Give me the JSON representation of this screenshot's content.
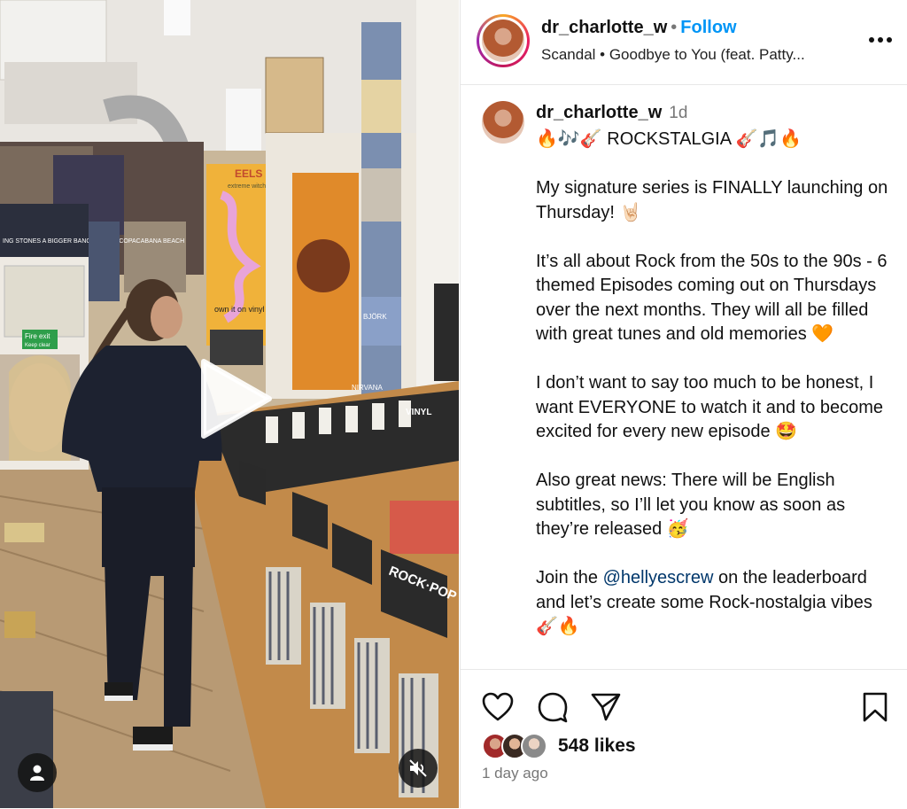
{
  "post": {
    "username": "dr_charlotte_w",
    "separator": "•",
    "follow_label": "Follow",
    "audio": "Scandal • Goodbye to You (feat. Patty...",
    "time_short": "1d",
    "caption_lines": [
      "🔥🎶🎸 ROCKSTALGIA 🎸🎵🔥",
      "",
      "My signature series is FINALLY launching on Thursday! 🤘🏻",
      "",
      "It’s all about Rock from the 50s to the 90s - 6 themed Episodes coming out on Thursdays over the next months. They will all be filled with great tunes and old memories 🧡",
      "",
      "I don’t want to say too much to be honest, I want EVERYONE to watch it and to become excited for every new episode 🤩",
      "",
      "Also great news: There will be English subtitles, so I’ll let you know as soon as they’re released 🥳",
      ""
    ],
    "last_line": {
      "before": "Join the ",
      "mention": "@hellyescrew",
      "after": " on the leaderboard and let’s create some Rock-nostalgia vibes 🎸🔥"
    },
    "likes": "548 likes",
    "time_ago": "1 day ago"
  },
  "media": {
    "poster_text": {
      "eels_title": "EELS",
      "eels_sub": "extreme witchcraft",
      "eels_foot": "own it on vinyl & cd",
      "fire_exit": "Fire exit",
      "keep_clear": "Keep clear",
      "rock_pop": "ROCK·POP",
      "vinyl": "VINYL",
      "stones": "ING STONES A BIGGER BANG LIVE ON COPACABANA BEACH",
      "bjork": "BJÖRK",
      "nirvana": "NIRVANA"
    }
  },
  "icons": {
    "play": "play-icon",
    "user_tag": "user-icon",
    "mute": "speaker-muted-icon",
    "more": "more-horizontal-icon",
    "like": "heart-icon",
    "comment": "comment-icon",
    "share": "paper-plane-icon",
    "save": "bookmark-icon"
  },
  "colors": {
    "follow": "#0095f6",
    "mention": "#00376b",
    "muted_text": "#777777"
  }
}
